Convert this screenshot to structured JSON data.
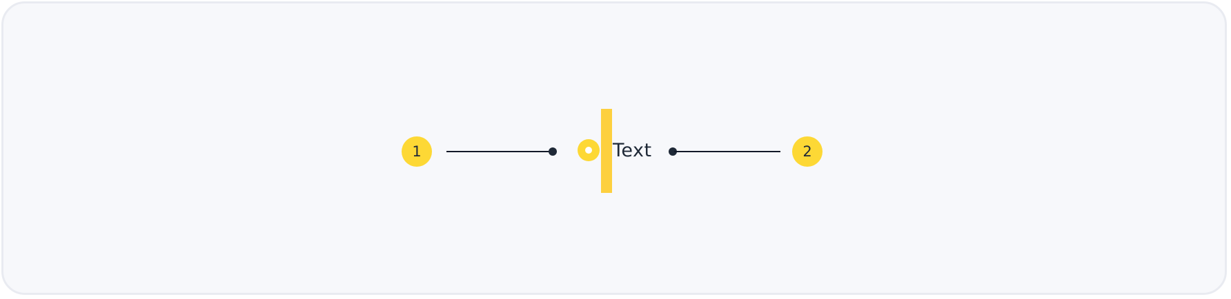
{
  "callouts": [
    {
      "number": "1"
    },
    {
      "number": "2"
    }
  ],
  "component": {
    "text": "Text",
    "accent_color": "#fdd835"
  },
  "icons": [
    "radio-button-icon",
    "text-cursor-icon"
  ]
}
